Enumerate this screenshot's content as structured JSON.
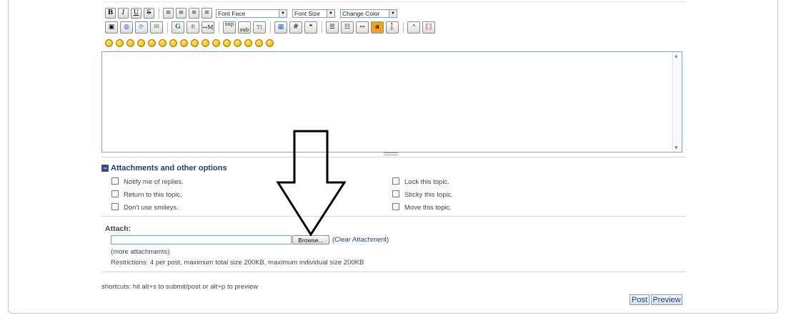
{
  "toolbar": {
    "row1_format": [
      "B",
      "I",
      "U",
      "S"
    ],
    "font_face": "Font Face",
    "font_size": "Font Size",
    "change_color": "Change Color",
    "row2_icons": [
      "G",
      "℗",
      "↔M",
      "sup",
      "sub",
      "Tt",
      "#"
    ]
  },
  "smiley_count": 16,
  "options": {
    "section_title": "Attachments and other options",
    "left": [
      "Notify me of replies.",
      "Return to this topic.",
      "Don't use smileys."
    ],
    "right": [
      "Lock this topic.",
      "Sticky this topic.",
      "Move this topic."
    ]
  },
  "attach": {
    "label": "Attach:",
    "browse": "Browse...",
    "clear": "(Clear Attachment)",
    "more": "(more attachments)",
    "restrictions": "Restrictions: 4 per post, maximum total size 200KB, maximum individual size 200KB"
  },
  "shortcuts": "shortcuts: hit alt+s to submit/post or alt+p to preview",
  "buttons": {
    "post": "Post",
    "preview": "Preview"
  }
}
